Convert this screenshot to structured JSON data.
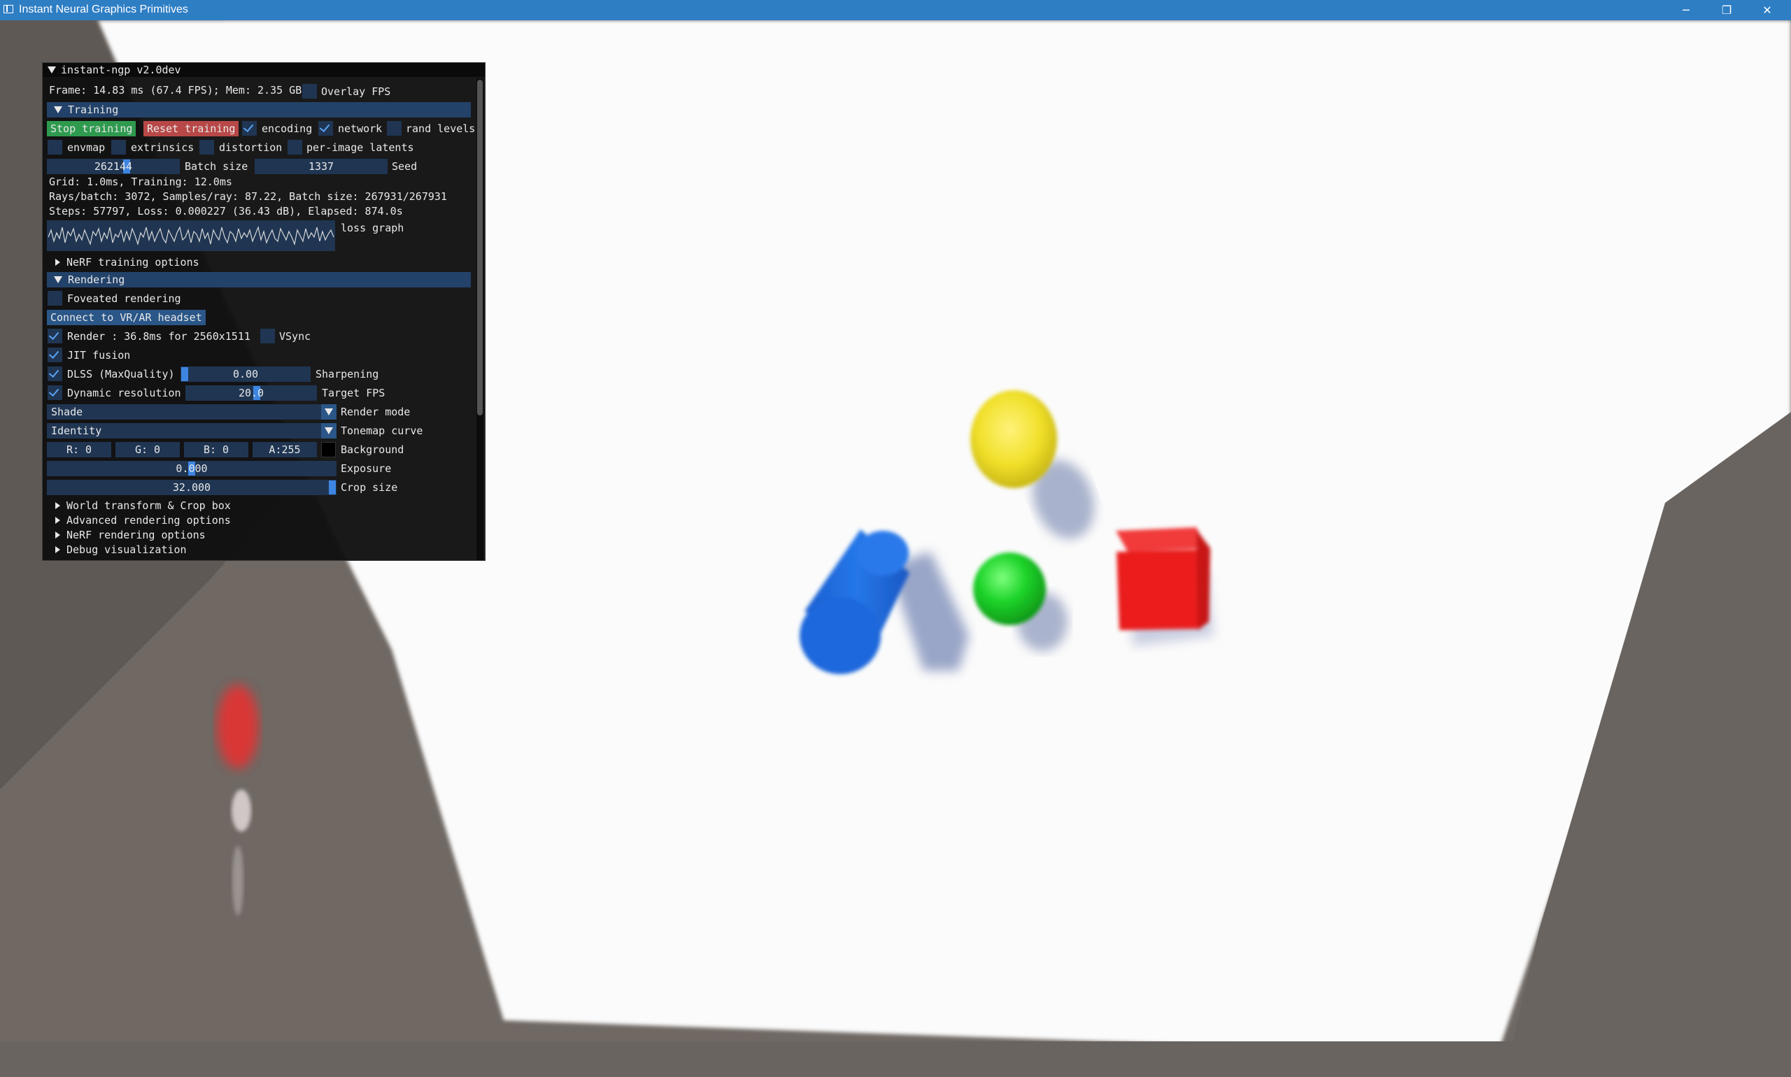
{
  "window": {
    "title": "Instant Neural Graphics Primitives"
  },
  "panel": {
    "title": "instant-ngp v2.0dev",
    "frame_info": "Frame: 14.83 ms (67.4 FPS); Mem: 2.35 GB",
    "overlay_fps_label": "Overlay FPS",
    "training": {
      "header": "Training",
      "stop_button": "Stop training",
      "reset_button": "Reset training",
      "encoding_label": "encoding",
      "network_label": "network",
      "rand_levels_label": "rand levels",
      "envmap_label": "envmap",
      "extrinsics_label": "extrinsics",
      "distortion_label": "distortion",
      "per_image_label": "per-image latents",
      "batch_size_value": "262144",
      "batch_size_label": "Batch size",
      "seed_value": "1337",
      "seed_label": "Seed",
      "timing": "Grid: 1.0ms, Training: 12.0ms",
      "rays": "Rays/batch: 3072, Samples/ray: 87.22, Batch size: 267931/267931",
      "steps": "Steps: 57797, Loss: 0.000227 (36.43 dB), Elapsed: 874.0s",
      "loss_graph_label": "loss graph",
      "nerf_training_options": "NeRF training options"
    },
    "rendering": {
      "header": "Rendering",
      "foveated_label": "Foveated rendering",
      "vr_button": "Connect to VR/AR headset",
      "render_label": "Render : 36.8ms for 2560x1511",
      "vsync_label": "VSync",
      "jit_label": "JIT fusion",
      "dlss_label": "DLSS (MaxQuality)",
      "sharpening_value": "0.00",
      "sharpening_label": "Sharpening",
      "dynres_label": "Dynamic resolution",
      "target_fps_value": "20.0",
      "target_fps_label": "Target FPS",
      "render_mode_value": "Shade",
      "render_mode_label": "Render mode",
      "tonemap_value": "Identity",
      "tonemap_label": "Tonemap curve",
      "bg_r": "R:  0",
      "bg_g": "G:  0",
      "bg_b": "B:  0",
      "bg_a": "A:255",
      "background_label": "Background",
      "background_color": "#000000",
      "exposure_value": "0.000",
      "exposure_label": "Exposure",
      "crop_value": "32.000",
      "crop_label": "Crop size",
      "world_transform": "World transform & Crop box",
      "advanced_options": "Advanced rendering options",
      "nerf_rendering_options": "NeRF rendering options",
      "debug_visualization": "Debug visualization"
    }
  },
  "colors": {
    "titlebar": "#2e7ec4",
    "stop_button": "#2e9a4e",
    "reset_button": "#b84848",
    "section_header": "#23426a",
    "frame_bg": "#1f3552",
    "accent": "#3d85e0"
  }
}
